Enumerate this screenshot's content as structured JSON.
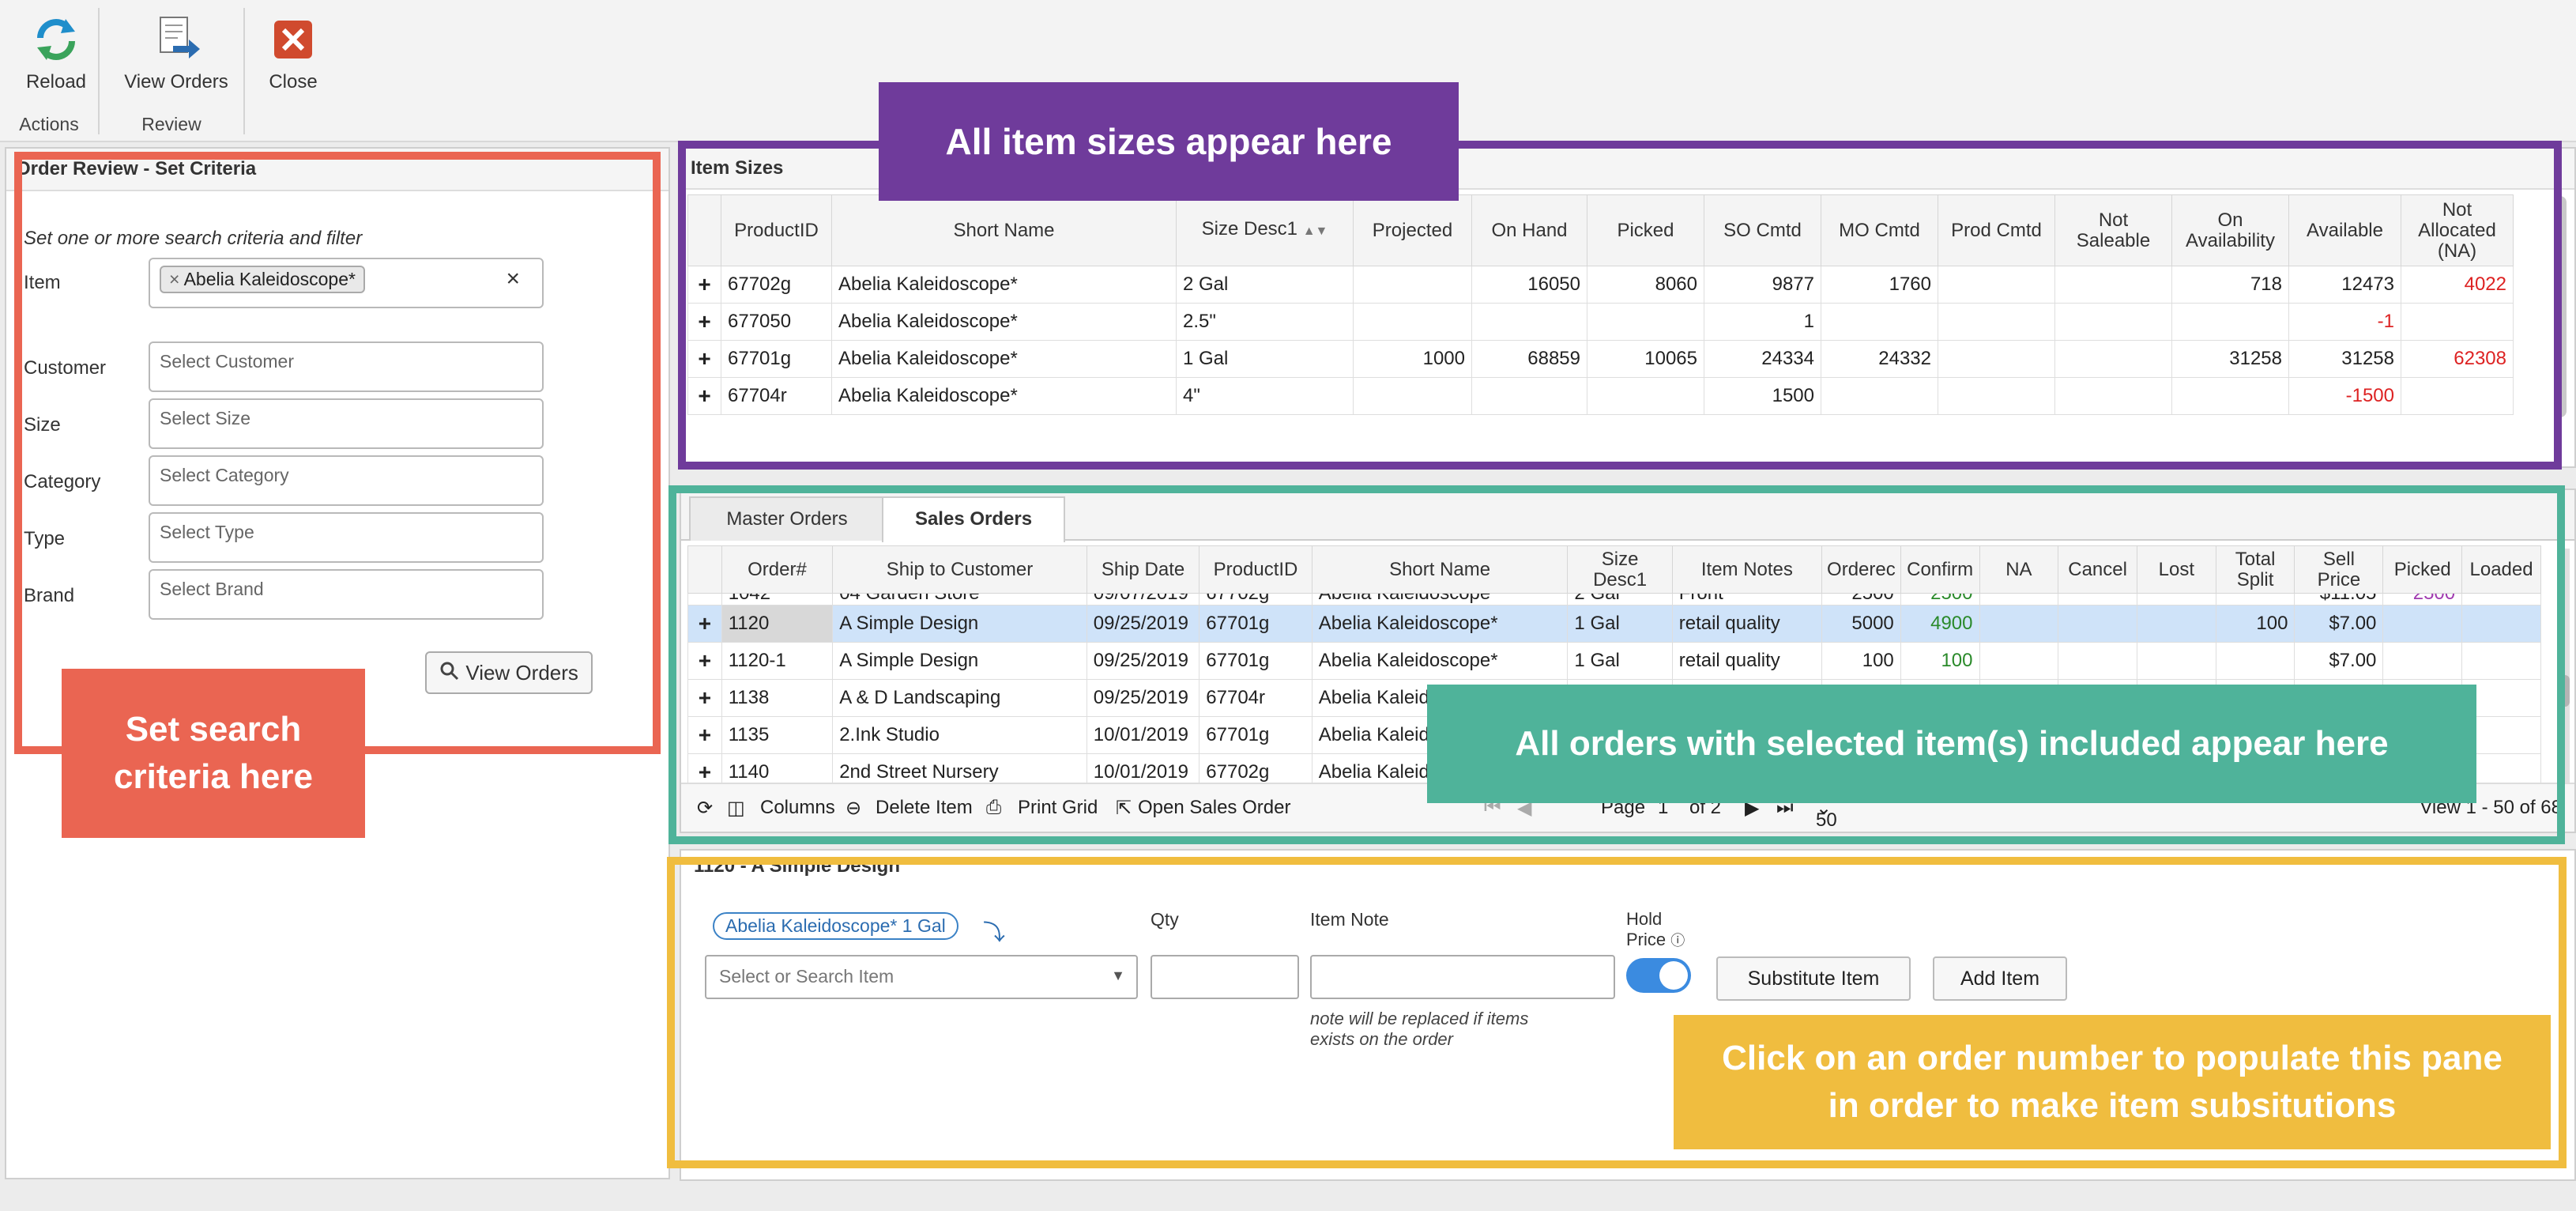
{
  "ribbon": {
    "reload": "Reload",
    "view_orders": "View Orders",
    "close": "Close",
    "group_actions": "Actions",
    "group_review": "Review"
  },
  "criteria": {
    "title": "Order Review - Set Criteria",
    "intro": "Set one or more search criteria and filter",
    "item_label": "Item",
    "item_tag": "Abelia Kaleidoscope*",
    "customer_label": "Customer",
    "customer_placeholder": "Select Customer",
    "size_label": "Size",
    "size_placeholder": "Select Size",
    "category_label": "Category",
    "category_placeholder": "Select Category",
    "type_label": "Type",
    "type_placeholder": "Select Type",
    "brand_label": "Brand",
    "brand_placeholder": "Select Brand",
    "view_orders_button": "View Orders"
  },
  "item_sizes": {
    "title": "Item Sizes",
    "columns": [
      "",
      "ProductID",
      "Short Name",
      "Size Desc1",
      "Projected",
      "On Hand",
      "Picked",
      "SO Cmtd",
      "MO Cmtd",
      "Prod Cmtd",
      "Not Saleable",
      "On Availability",
      "Available",
      "Not Allocated (NA)"
    ],
    "rows": [
      {
        "product_id": "67702g",
        "short_name": "Abelia Kaleidoscope*",
        "size": "2 Gal",
        "projected": "",
        "on_hand": "16050",
        "picked": "8060",
        "so_cmtd": "9877",
        "mo_cmtd": "1760",
        "prod_cmtd": "",
        "not_saleable": "",
        "on_availability": "718",
        "available": "12473",
        "not_allocated": "4022"
      },
      {
        "product_id": "677050",
        "short_name": "Abelia Kaleidoscope*",
        "size": "2.5\"",
        "projected": "",
        "on_hand": "",
        "picked": "",
        "so_cmtd": "1",
        "mo_cmtd": "",
        "prod_cmtd": "",
        "not_saleable": "",
        "on_availability": "",
        "available": "-1",
        "not_allocated": ""
      },
      {
        "product_id": "67701g",
        "short_name": "Abelia Kaleidoscope*",
        "size": "1 Gal",
        "projected": "1000",
        "on_hand": "68859",
        "picked": "10065",
        "so_cmtd": "24334",
        "mo_cmtd": "24332",
        "prod_cmtd": "",
        "not_saleable": "",
        "on_availability": "31258",
        "available": "31258",
        "not_allocated": "62308"
      },
      {
        "product_id": "67704r",
        "short_name": "Abelia Kaleidoscope*",
        "size": "4\"",
        "projected": "",
        "on_hand": "",
        "picked": "",
        "so_cmtd": "1500",
        "mo_cmtd": "",
        "prod_cmtd": "",
        "not_saleable": "",
        "on_availability": "",
        "available": "-1500",
        "not_allocated": ""
      }
    ]
  },
  "sales": {
    "tab_master": "Master Orders",
    "tab_sales": "Sales Orders",
    "columns": [
      "",
      "Order#",
      "Ship to Customer",
      "Ship Date",
      "ProductID",
      "Short Name",
      "Size Desc1",
      "Item Notes",
      "Orderec",
      "Confirm",
      "NA",
      "Cancel",
      "Lost",
      "Total Split",
      "Sell Price",
      "Picked",
      "Loaded"
    ],
    "partial_row": {
      "order": "1042",
      "customer": "04 Garden Store",
      "ship_date": "09/07/2019",
      "product_id": "67702g",
      "short_name": "Abelia Kaleidoscope*",
      "size": "2 Gal",
      "notes": "Front",
      "ordered": "2500",
      "confirm": "2500",
      "sell_price": "$11.05",
      "picked": "2500"
    },
    "rows": [
      {
        "order": "1120",
        "customer": "A Simple Design",
        "ship_date": "09/25/2019",
        "product_id": "67701g",
        "short_name": "Abelia Kaleidoscope*",
        "size": "1 Gal",
        "notes": "retail quality",
        "ordered": "5000",
        "confirm": "4900",
        "total_split": "100",
        "sell_price": "$7.00"
      },
      {
        "order": "1120-1",
        "customer": "A Simple Design",
        "ship_date": "09/25/2019",
        "product_id": "67701g",
        "short_name": "Abelia Kaleidoscope*",
        "size": "1 Gal",
        "notes": "retail quality",
        "ordered": "100",
        "confirm": "100",
        "total_split": "",
        "sell_price": "$7.00"
      },
      {
        "order": "1138",
        "customer": "A & D Landscaping",
        "ship_date": "09/25/2019",
        "product_id": "67704r",
        "short_name": "Abelia Kaleid"
      },
      {
        "order": "1135",
        "customer": "2.Ink Studio",
        "ship_date": "10/01/2019",
        "product_id": "67701g",
        "short_name": "Abelia Kaleid"
      },
      {
        "order": "1140",
        "customer": "2nd Street Nursery",
        "ship_date": "10/01/2019",
        "product_id": "67702g",
        "short_name": "Abelia Kaleid"
      }
    ],
    "pager": {
      "columns": "Columns",
      "delete_item": "Delete Item",
      "print_grid": "Print Grid",
      "open_sales_order": "Open Sales Order",
      "page_label": "Page",
      "page": "1",
      "of_label": "of 2",
      "per_page": "50",
      "view_range": "View 1 - 50 of 68"
    }
  },
  "detail": {
    "title": "1120 - A Simple Design",
    "item_chip": "Abelia Kaleidoscope* 1 Gal",
    "select_placeholder": "Select or Search Item",
    "qty_label": "Qty",
    "item_note_label": "Item Note",
    "note_hint_1": "note will be replaced if items",
    "note_hint_2": "exists on the order",
    "hold_label_1": "Hold",
    "hold_label_2": "Price",
    "substitute_button": "Substitute Item",
    "add_button": "Add Item"
  },
  "callouts": {
    "item_sizes": "All item sizes appear here",
    "search": "Set search criteria here",
    "orders": "All orders with selected item(s) included appear here",
    "pane": "Click on an order number to populate this pane in order to make item subsitutions"
  },
  "colors": {
    "purple": "#6f3b9b",
    "red": "#ea6552",
    "teal": "#4fb39a",
    "yellow": "#f0bd3f",
    "selected_row": "#cfe3f9"
  }
}
